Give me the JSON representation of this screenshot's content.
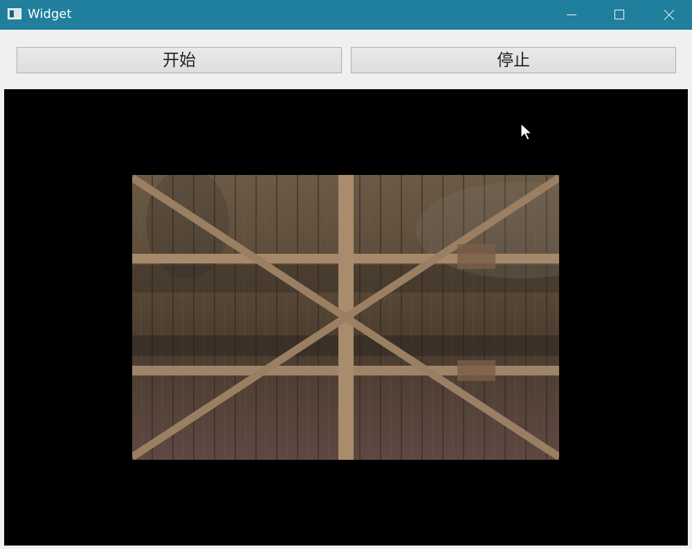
{
  "window": {
    "title": "Widget",
    "icons": {
      "app": "app-window-icon",
      "minimize": "minimize-icon",
      "maximize": "maximize-icon",
      "close": "close-icon"
    }
  },
  "toolbar": {
    "start_label": "开始",
    "stop_label": "停止"
  },
  "video": {
    "background": "#000000",
    "frame_description_icon": "wooden-ceiling-video-frame"
  },
  "colors": {
    "titlebar": "#1f7f9c",
    "button_bg": "#e1e1e1",
    "button_border": "#adadad"
  }
}
